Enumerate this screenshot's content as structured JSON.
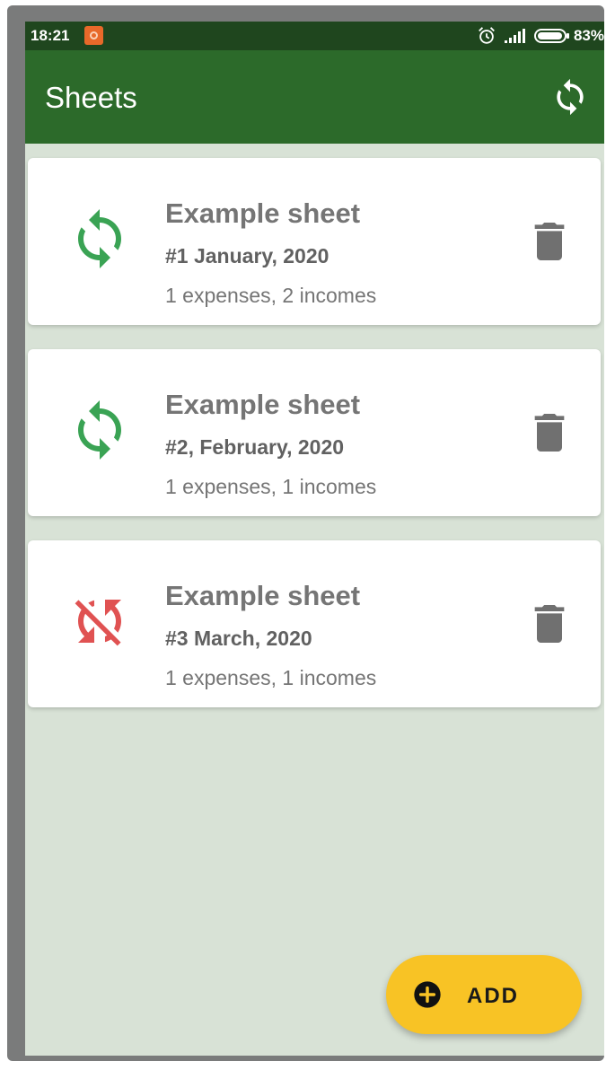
{
  "status_bar": {
    "time": "18:21",
    "battery": "83%"
  },
  "app_bar": {
    "title": "Sheets",
    "sync_icon": "sync-icon"
  },
  "sheets": [
    {
      "title": "Example sheet",
      "date": "#1 January, 2020",
      "summary": "1 expenses, 2 incomes",
      "sync_state": "synced"
    },
    {
      "title": "Example sheet",
      "date": "#2, February, 2020",
      "summary": "1 expenses, 1 incomes",
      "sync_state": "synced"
    },
    {
      "title": "Example sheet",
      "date": "#3 March, 2020",
      "summary": "1 expenses, 1 incomes",
      "sync_state": "sync-disabled"
    }
  ],
  "fab": {
    "label": "ADD",
    "icon": "plus-circle-icon"
  },
  "colors": {
    "status_bar": "#1f461e",
    "app_bar": "#2c6a2a",
    "background": "#d8e2d6",
    "synced": "#3aa354",
    "sync_disabled": "#e05252",
    "fab": "#f8c325"
  }
}
